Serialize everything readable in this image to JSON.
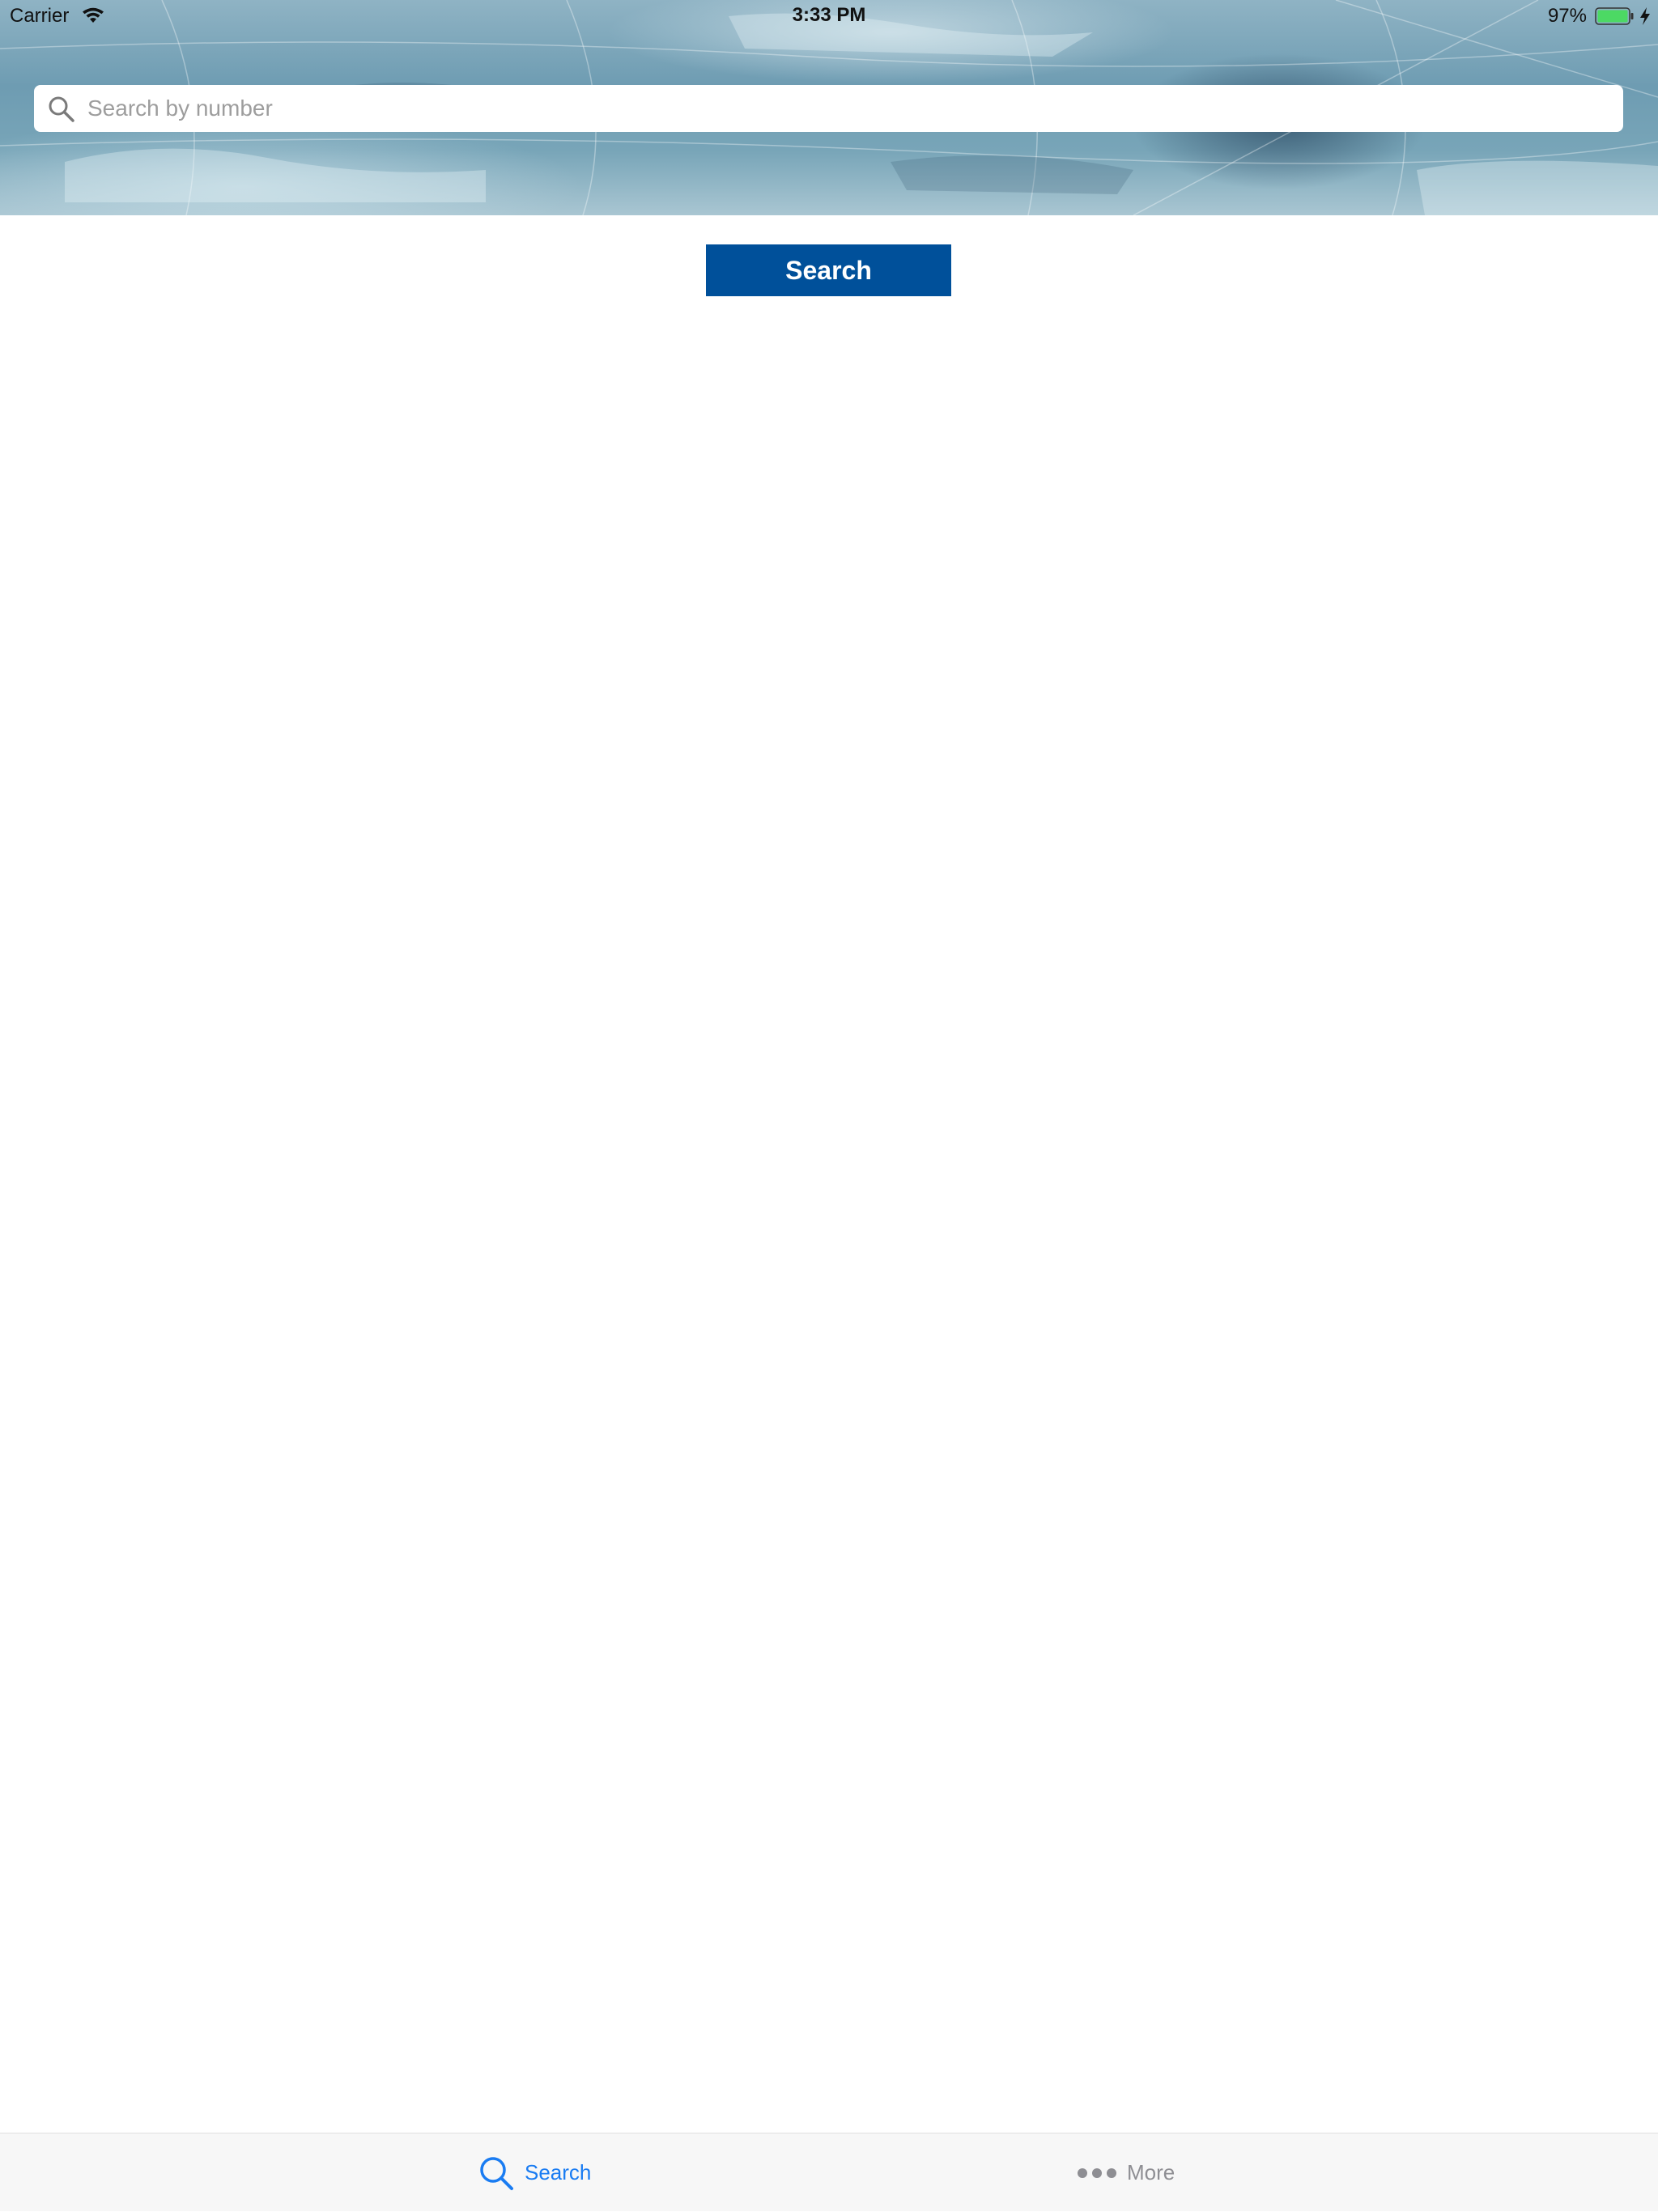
{
  "status_bar": {
    "carrier": "Carrier",
    "time": "3:33 PM",
    "battery_percent": "97%"
  },
  "search": {
    "placeholder": "Search by number",
    "value": "",
    "button_label": "Search"
  },
  "tab_bar": {
    "items": [
      {
        "label": "Search",
        "icon": "search-icon",
        "selected": true
      },
      {
        "label": "More",
        "icon": "more-icon",
        "selected": false
      }
    ]
  },
  "colors": {
    "button_bg": "#00509a",
    "tab_active": "#1a7cf2",
    "tab_inactive": "#8e8e93",
    "battery_green": "#4cd964"
  }
}
